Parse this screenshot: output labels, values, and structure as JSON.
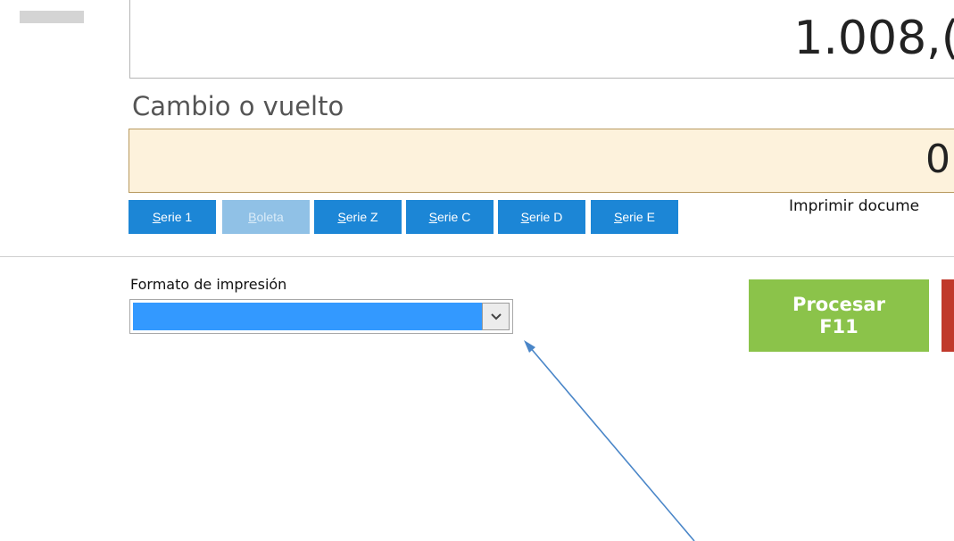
{
  "total": {
    "value": "1.008,("
  },
  "change": {
    "label": "Cambio o vuelto",
    "value": "0"
  },
  "series": [
    {
      "label": "Serie 1",
      "enabled": true
    },
    {
      "label": "Boleta",
      "enabled": false
    },
    {
      "label": "Serie Z",
      "enabled": true
    },
    {
      "label": "Serie C",
      "enabled": true
    },
    {
      "label": "Serie D",
      "enabled": true
    },
    {
      "label": "Serie E",
      "enabled": true
    }
  ],
  "print_doc": {
    "label": "Imprimir docume"
  },
  "format": {
    "label": "Formato de impresión",
    "selected": ""
  },
  "process": {
    "line1": "Procesar",
    "line2": "F11"
  },
  "colors": {
    "series_button": "#1c86d6",
    "series_button_disabled": "#90c1e6",
    "process_button": "#8bc34a",
    "change_background": "#fdf2dc",
    "select_highlight": "#3399ff",
    "red_button": "#c0392b",
    "annotation_arrow": "#4a86c8"
  },
  "icons": {
    "dropdown": "chevron-down-icon",
    "annotation": "annotation-arrow"
  }
}
